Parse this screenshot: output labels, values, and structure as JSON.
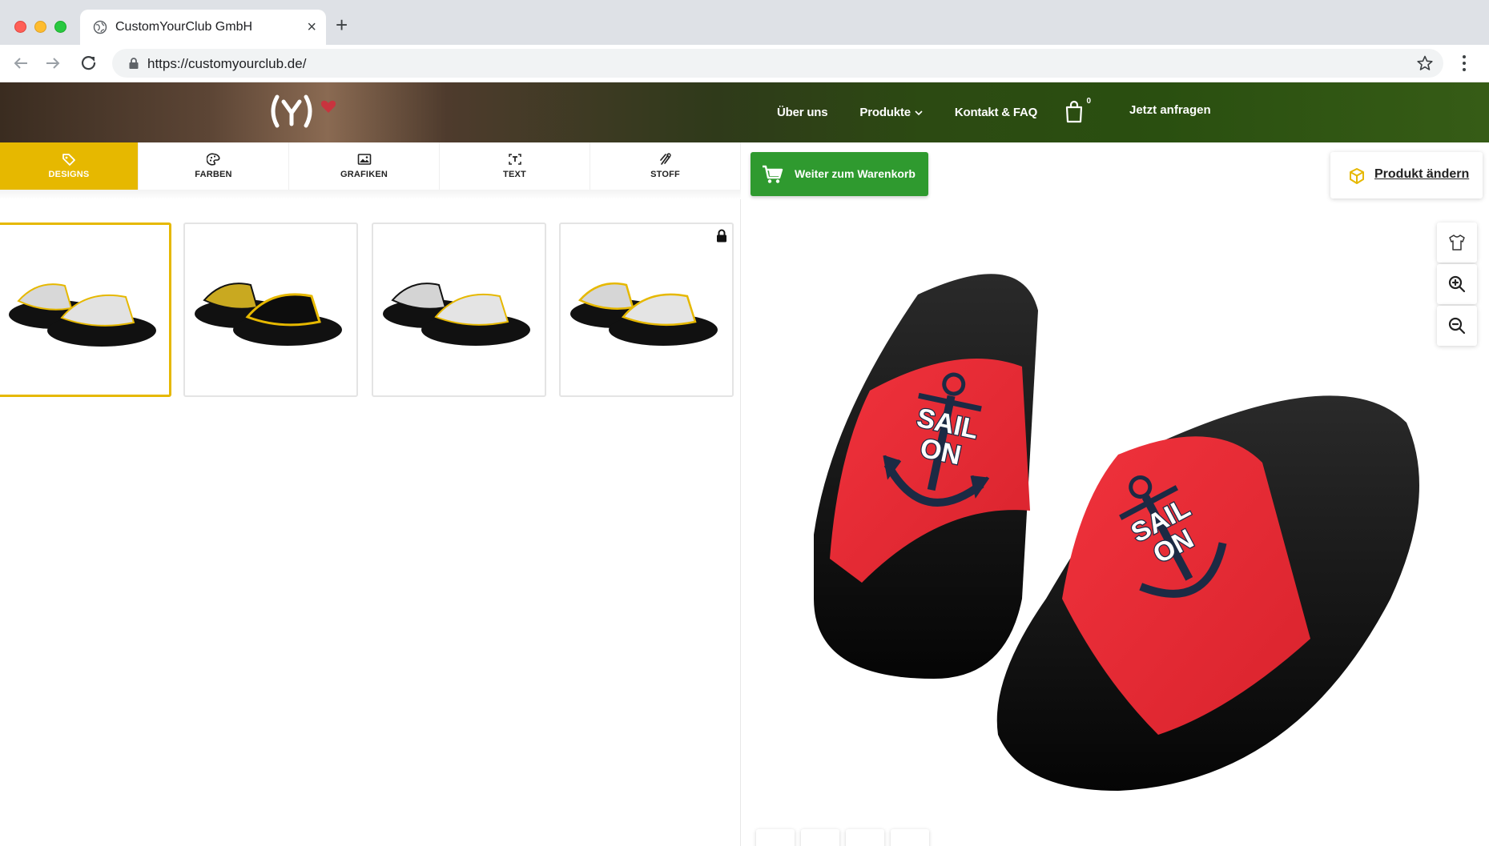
{
  "browser": {
    "tab_title": "CustomYourClub GmbH",
    "url": "https://customyourclub.de/",
    "new_tab_symbol": "+",
    "close_symbol": "×"
  },
  "site": {
    "logo_text": "(y)",
    "nav": [
      {
        "label": "Über uns"
      },
      {
        "label": "Produkte"
      },
      {
        "label": "Kontakt & FAQ"
      }
    ],
    "cart_count": "0",
    "cta": "Jetzt anfragen",
    "accent": "#e6b800",
    "brand_heart": "#c8343e"
  },
  "tools": {
    "tabs": [
      {
        "label": "DESIGNS",
        "icon": "tag-icon",
        "active": true
      },
      {
        "label": "FARBEN",
        "icon": "palette-icon",
        "active": false
      },
      {
        "label": "GRAFIKEN",
        "icon": "image-icon",
        "active": false
      },
      {
        "label": "TEXT",
        "icon": "text-icon",
        "active": false
      },
      {
        "label": "STOFF",
        "icon": "fabric-icon",
        "active": false
      }
    ]
  },
  "designs": [
    {
      "name": "white-yellow-trim",
      "selected": true,
      "locked": false
    },
    {
      "name": "yellow-black",
      "selected": false,
      "locked": false
    },
    {
      "name": "white-black",
      "selected": false,
      "locked": false
    },
    {
      "name": "white-yellow-locked",
      "selected": false,
      "locked": true
    }
  ],
  "actions": {
    "cart_button": "Weiter zum Warenkorb",
    "change_product": "Produkt ändern",
    "cart_green": "#2f9a2f"
  },
  "preview": {
    "strap_color": "#e8303a",
    "sole_color": "#111111",
    "graphic_text": [
      "SAIL",
      "ON"
    ]
  }
}
